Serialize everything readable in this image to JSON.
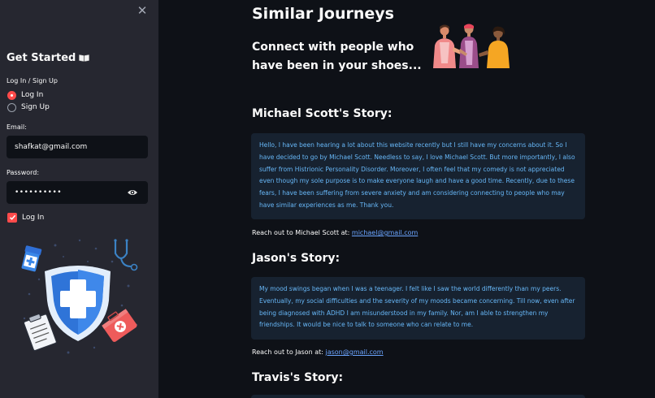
{
  "sidebar": {
    "close_symbol": "✕",
    "title": "Get Started",
    "title_icon": "book-icon",
    "auth_label": "Log In / Sign Up",
    "auth_options": [
      "Log In",
      "Sign Up"
    ],
    "auth_selected": "Log In",
    "email_label": "Email:",
    "email_value": "shafkat@gmail.com",
    "password_label": "Password:",
    "password_value": "••••••••••",
    "login_checkbox_label": "Log In",
    "login_checkbox_checked": true,
    "accent_color": "#ff4b4b"
  },
  "main": {
    "title": "Similar Journeys",
    "subtitle_line1": "Connect with people who",
    "subtitle_line2": "have been in your shoes...",
    "stories": [
      {
        "heading": "Michael Scott's Story:",
        "text": "Hello, I have been hearing a lot about this website recently but I still have my concerns about it. So I have decided to go by Michael Scott. Needless to say, I love Michael Scott. But more importantly, I also suffer from Histrionic Personality Disorder. Moreover, I often feel that my comedy is not appreciated even though my sole purpose is to make everyone laugh and have a good time. Recently, due to these fears, I have been suffering from severe anxiety and am considering connecting to people who may have similar experiences as me. Thank you.",
        "reach_prefix": "Reach out to Michael Scott at:",
        "email": "michael@gmail.com"
      },
      {
        "heading": "Jason's Story:",
        "text": "My mood swings began when I was a teenager. I felt like I saw the world differently than my peers. Eventually, my social difficulties and the severity of my moods became concerning. Till now, even after being diagnosed with ADHD I am misunderstood in my family. Nor, am I able to strengthen my friendships. It would be nice to talk to someone who can relate to me.",
        "reach_prefix": "Reach out to Jason at:",
        "email": "jason@gmail.com"
      },
      {
        "heading": "Travis's Story:"
      }
    ],
    "story_box_color": "#172230",
    "story_text_color": "#67b7f7",
    "link_color": "#6ba5ff"
  }
}
